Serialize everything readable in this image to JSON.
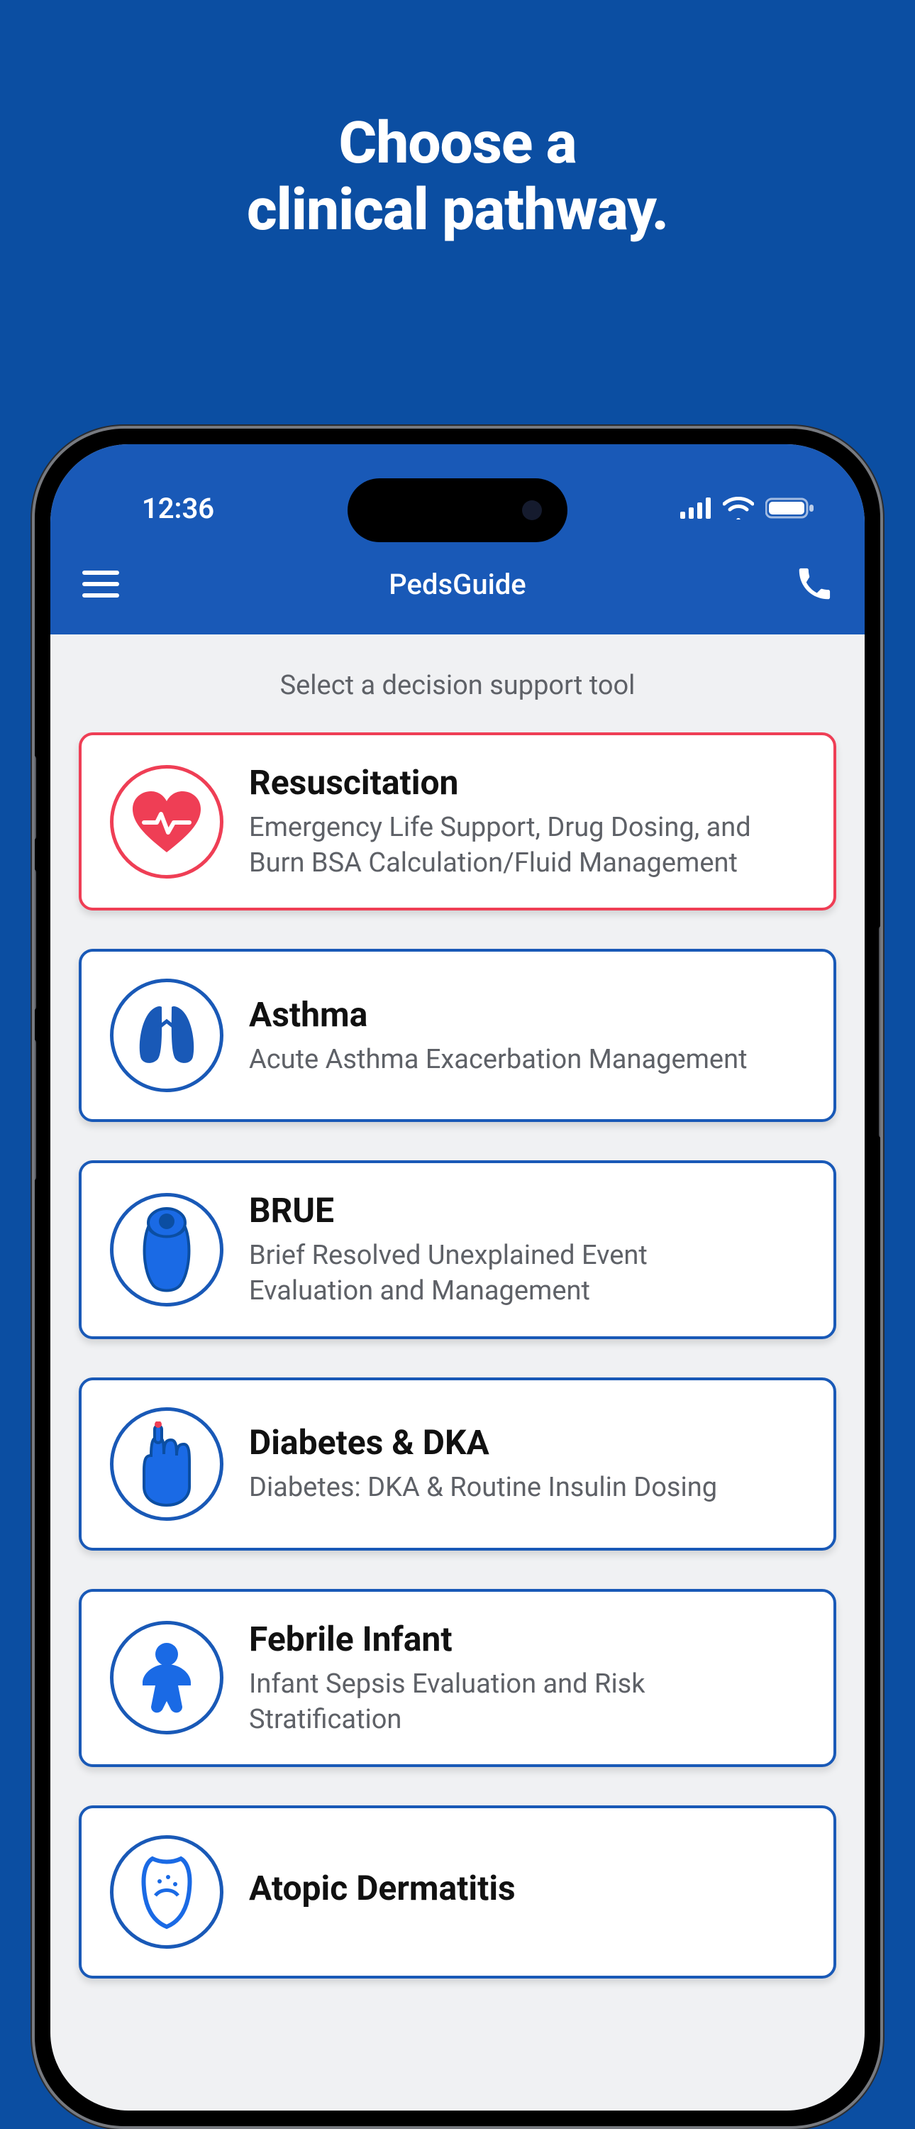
{
  "marketing_headline_line1": "Choose a",
  "marketing_headline_line2": "clinical pathway.",
  "status": {
    "time": "12:36"
  },
  "nav": {
    "title": "PedsGuide"
  },
  "content": {
    "subtitle": "Select a decision support tool"
  },
  "cards": [
    {
      "title": "Resuscitation",
      "desc": "Emergency Life Support, Drug Dosing, and Burn BSA Calculation/Fluid Management",
      "highlight": true
    },
    {
      "title": "Asthma",
      "desc": "Acute Asthma Exacerbation Management",
      "highlight": false
    },
    {
      "title": "BRUE",
      "desc": "Brief Resolved Unexplained Event Evaluation and Management",
      "highlight": false
    },
    {
      "title": "Diabetes & DKA",
      "desc": "Diabetes: DKA & Routine Insulin Dosing",
      "highlight": false
    },
    {
      "title": "Febrile Infant",
      "desc": "Infant Sepsis Evaluation and Risk Stratification",
      "highlight": false
    },
    {
      "title": "Atopic Dermatitis",
      "desc": "",
      "highlight": false
    }
  ]
}
